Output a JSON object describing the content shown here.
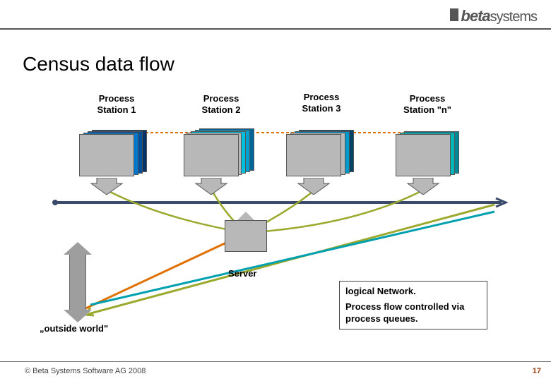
{
  "brand": {
    "part1": "beta",
    "part2": "systems"
  },
  "title": "Census data flow",
  "stations": {
    "s1": "Process\nStation 1",
    "s2": "Process\nStation 2",
    "s3": "Process\nStation 3",
    "sn": "Process\nStation \"n\""
  },
  "server_label": "Server",
  "outside_world_label": "„outside world\"",
  "info": {
    "line1": "logical Network.",
    "line2": "Process flow controlled via process queues."
  },
  "footer": {
    "copyright": "© Beta Systems Software AG 2008",
    "page": "17"
  },
  "colors": {
    "gray_box": "#b8b8b8",
    "olive_line": "#9aa92b",
    "orange_line": "#e07000",
    "teal_line": "#00a0b0",
    "navy_bus": "#3a4a6b"
  }
}
